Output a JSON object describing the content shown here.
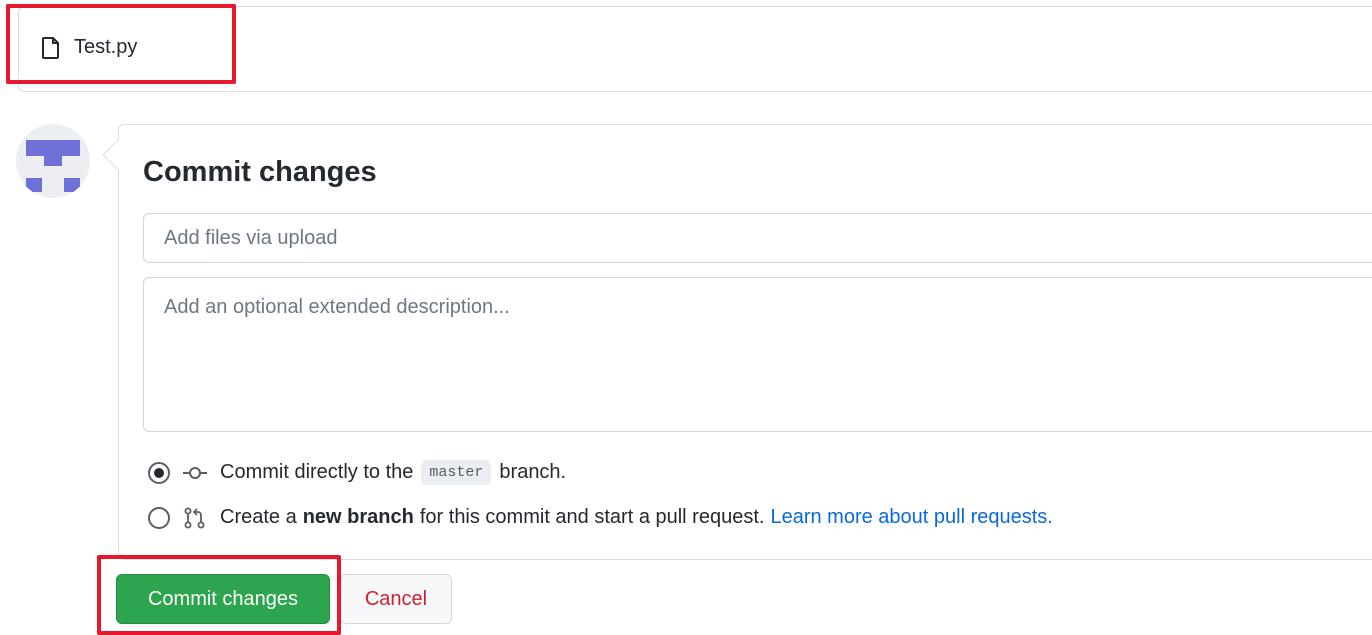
{
  "file_list": {
    "files": [
      {
        "name": "Test.py",
        "icon": "file-icon"
      }
    ]
  },
  "commit_form": {
    "title": "Commit changes",
    "summary_placeholder": "Add files via upload",
    "description_placeholder": "Add an optional extended description...",
    "options": {
      "direct": {
        "selected": true,
        "icon": "git-commit-icon",
        "text_before": "Commit directly to the",
        "branch": "master",
        "text_after": "branch."
      },
      "new_branch": {
        "selected": false,
        "icon": "git-pull-request-icon",
        "text_before": "Create a",
        "bold": "new branch",
        "text_after": "for this commit and start a pull request.",
        "link": "Learn more about pull requests."
      }
    }
  },
  "actions": {
    "commit_label": "Commit changes",
    "cancel_label": "Cancel"
  },
  "colors": {
    "primary_button": "#2da44e",
    "danger_text": "#cf222e",
    "link": "#0969da",
    "highlight": "#e5192b",
    "avatar": "#6f6fd8"
  }
}
